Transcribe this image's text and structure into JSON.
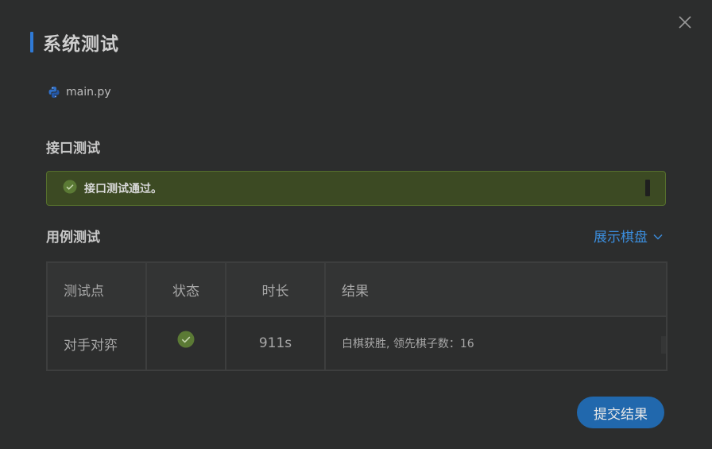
{
  "dialog": {
    "title": "系统测试",
    "close_icon": "close-icon"
  },
  "file": {
    "icon": "python-icon",
    "name": "main.py"
  },
  "api_test": {
    "section_title": "接口测试",
    "status_icon": "check-circle-icon",
    "message": "接口测试通过。",
    "status_color": "#56702d"
  },
  "case_test": {
    "section_title": "用例测试",
    "toggle_label": "展示棋盘",
    "toggle_icon": "chevron-down-icon",
    "columns": [
      "测试点",
      "状态",
      "时长",
      "结果"
    ],
    "rows": [
      {
        "name": "对手对弈",
        "status_icon": "check-circle-icon",
        "duration": "911s",
        "result": "白棋获胜, 领先棋子数：16"
      }
    ]
  },
  "actions": {
    "submit_label": "提交结果"
  },
  "colors": {
    "accent": "#2f7ad6",
    "link": "#3b8ede",
    "success": "#5b7a35",
    "button": "#2168ad"
  }
}
